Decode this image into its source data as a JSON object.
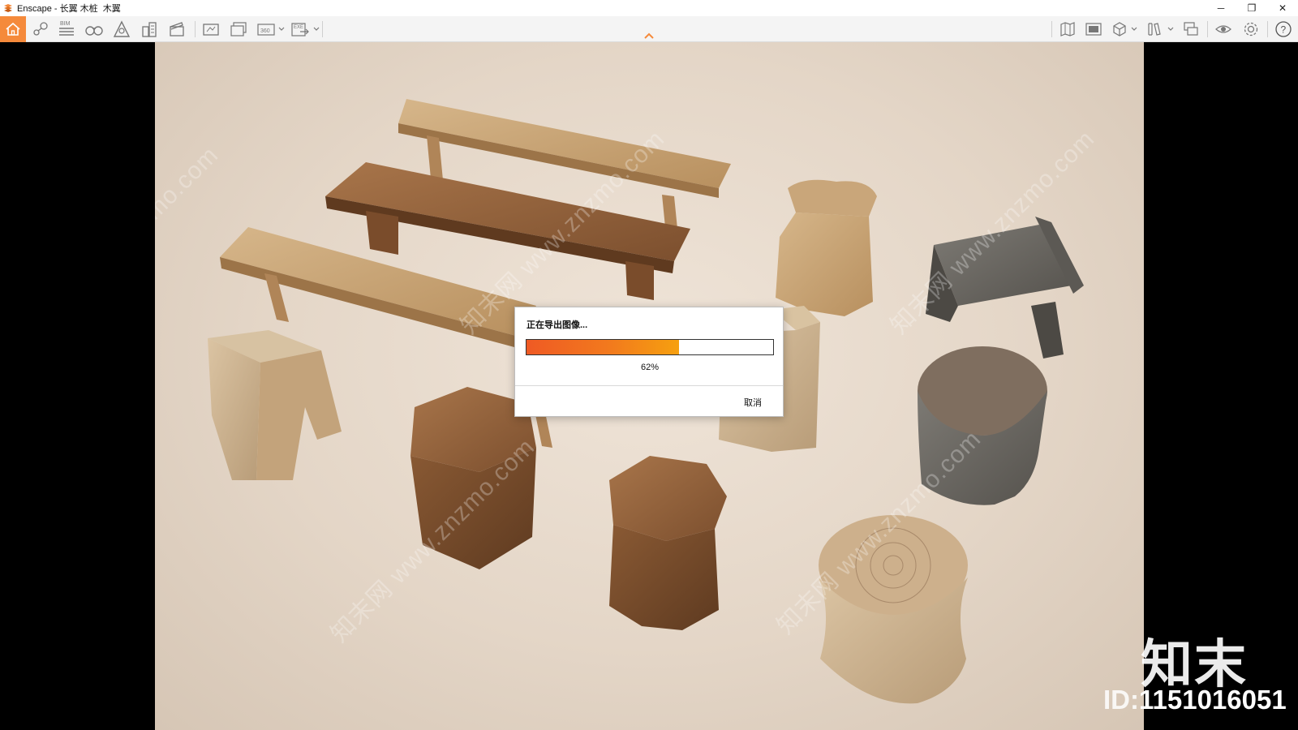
{
  "window": {
    "title": "Enscape - 长翼 木桩  木翼",
    "controls": {
      "minimize": "─",
      "restore": "❐",
      "close": "✕"
    }
  },
  "toolbar": {
    "left_tools": [
      "home-icon",
      "location-icon",
      "bim-icon",
      "binoculars-icon",
      "asset-library-icon",
      "buildings-icon",
      "clapperboard-icon"
    ],
    "export_tools": [
      "screenshot-icon",
      "batch-render-icon",
      "panorama-360-icon",
      "exe-export-icon"
    ],
    "right_tools": [
      "map-icon",
      "views-icon",
      "cube-icon",
      "books-icon",
      "collaboration-icon",
      "visibility-icon",
      "settings-icon",
      "help-icon"
    ],
    "bim_label": "BIM",
    "panorama_label": "360",
    "exe_label": "EXE",
    "accent_color": "#f58a3b"
  },
  "dialog": {
    "title": "正在导出图像...",
    "progress": 0.62,
    "progress_text": "62%",
    "cancel_label": "取消"
  },
  "watermark": {
    "text": "知末网 www.znzmo.com"
  },
  "branding": {
    "logo_text": "知末",
    "id_label": "ID:",
    "id_value": "1151016051"
  }
}
